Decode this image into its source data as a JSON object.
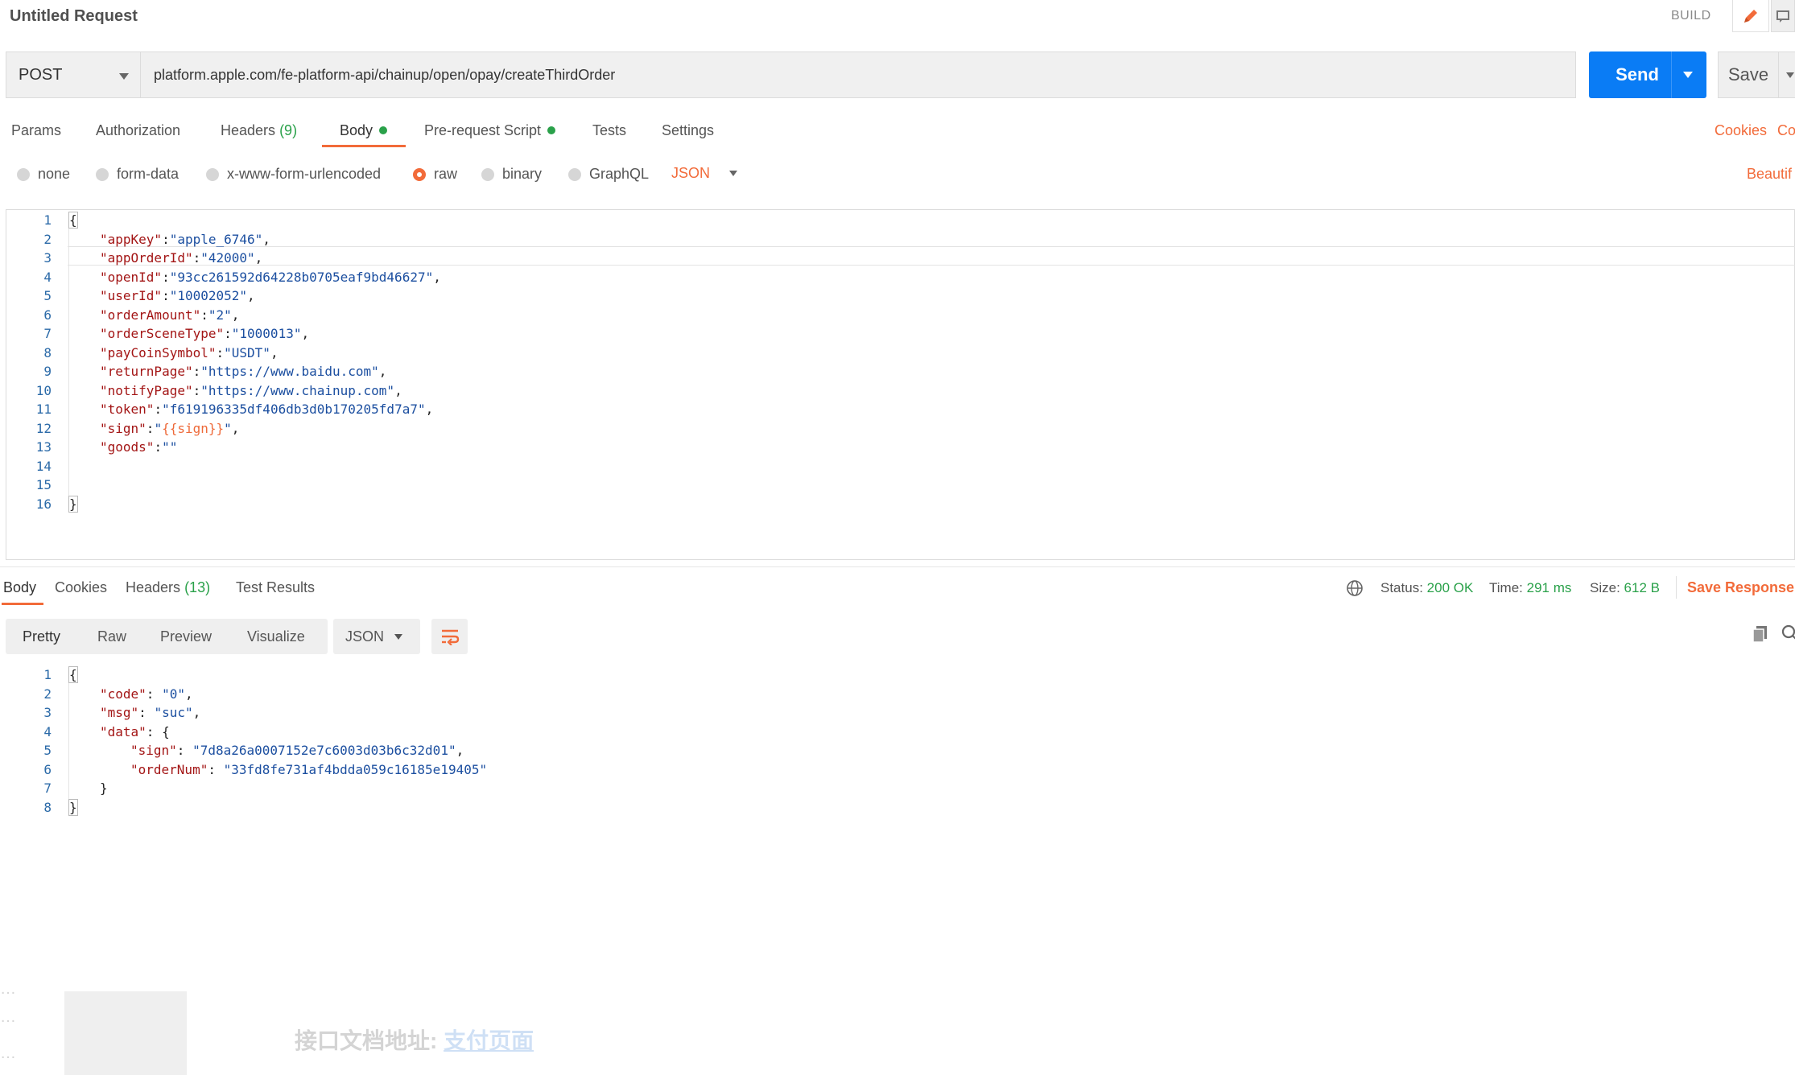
{
  "header": {
    "title": "Untitled Request",
    "build_label": "BUILD"
  },
  "request": {
    "method": "POST",
    "url": "platform.apple.com/fe-platform-api/chainup/open/opay/createThirdOrder",
    "send_label": "Send",
    "save_label": "Save"
  },
  "tabs": [
    {
      "label": "Params"
    },
    {
      "label": "Authorization"
    },
    {
      "label": "Headers",
      "count": "(9)"
    },
    {
      "label": "Body",
      "active": true
    },
    {
      "label": "Pre-request Script"
    },
    {
      "label": "Tests"
    },
    {
      "label": "Settings"
    }
  ],
  "tab_links": {
    "cookies": "Cookies",
    "code": "Co"
  },
  "body_types": [
    "none",
    "form-data",
    "x-www-form-urlencoded",
    "raw",
    "binary",
    "GraphQL"
  ],
  "body_type_selected": "raw",
  "body_format": "JSON",
  "beautify_label": "Beautif",
  "request_body": [
    {
      "n": "1",
      "key": "",
      "value": "",
      "brace": "{"
    },
    {
      "n": "2",
      "key": "\"appKey\"",
      "value": "\"apple_6746\"",
      "sep": ":",
      "tail": ","
    },
    {
      "n": "3",
      "key": "\"appOrderId\"",
      "value": "\"42000\"",
      "sep": ":",
      "tail": ","
    },
    {
      "n": "4",
      "key": "\"openId\"",
      "value": "\"93cc261592d64228b0705eaf9bd46627\"",
      "sep": ":",
      "tail": ","
    },
    {
      "n": "5",
      "key": "\"userId\"",
      "value": "\"10002052\"",
      "sep": ":",
      "tail": ","
    },
    {
      "n": "6",
      "key": "\"orderAmount\"",
      "value": "\"2\"",
      "sep": ":",
      "tail": ","
    },
    {
      "n": "7",
      "key": "\"orderSceneType\"",
      "value": "\"1000013\"",
      "sep": ":",
      "tail": ","
    },
    {
      "n": "8",
      "key": "\"payCoinSymbol\"",
      "value": "\"USDT\"",
      "sep": ":",
      "tail": ","
    },
    {
      "n": "9",
      "key": "\"returnPage\"",
      "value": "\"https://www.baidu.com\"",
      "sep": ":",
      "tail": ","
    },
    {
      "n": "10",
      "key": "\"notifyPage\"",
      "value": "\"https://www.chainup.com\"",
      "sep": ":",
      "tail": ","
    },
    {
      "n": "11",
      "key": "\"token\"",
      "value": "\"f619196335df406db3d0b170205fd7a7\"",
      "sep": ":",
      "tail": ","
    },
    {
      "n": "12",
      "key": "\"sign\"",
      "value": "{{sign}}",
      "sep": ":",
      "tail": ",",
      "variable": true
    },
    {
      "n": "13",
      "key": "\"goods\"",
      "value": "\"\"",
      "sep": ":",
      "tail": ""
    },
    {
      "n": "14",
      "key": "",
      "value": ""
    },
    {
      "n": "15",
      "key": "",
      "value": ""
    },
    {
      "n": "16",
      "key": "",
      "value": "",
      "brace": "}"
    }
  ],
  "response_tabs": [
    {
      "label": "Body",
      "active": true
    },
    {
      "label": "Cookies"
    },
    {
      "label": "Headers",
      "count": "(13)"
    },
    {
      "label": "Test Results"
    }
  ],
  "status": {
    "status_label": "Status:",
    "status_value": "200 OK",
    "time_label": "Time:",
    "time_value": "291 ms",
    "size_label": "Size:",
    "size_value": "612 B",
    "save_response": "Save Response"
  },
  "view_modes": [
    "Pretty",
    "Raw",
    "Preview",
    "Visualize"
  ],
  "response_format": "JSON",
  "response_body": [
    {
      "n": "1",
      "text": "{"
    },
    {
      "n": "2",
      "key": "\"code\"",
      "value": "\"0\"",
      "indent": 1,
      "tail": ","
    },
    {
      "n": "3",
      "key": "\"msg\"",
      "value": "\"suc\"",
      "indent": 1,
      "tail": ","
    },
    {
      "n": "4",
      "key": "\"data\"",
      "value": "{",
      "indent": 1,
      "tail": "",
      "plainValue": true
    },
    {
      "n": "5",
      "key": "\"sign\"",
      "value": "\"7d8a26a0007152e7c6003d03b6c32d01\"",
      "indent": 2,
      "tail": ","
    },
    {
      "n": "6",
      "key": "\"orderNum\"",
      "value": "\"33fd8fe731af4bdda059c16185e19405\"",
      "indent": 2,
      "tail": ""
    },
    {
      "n": "7",
      "text": "}",
      "indent": 1
    },
    {
      "n": "8",
      "text": "}"
    }
  ],
  "overlay": {
    "line2_label": "接口文档地址:",
    "line2_link": "支付页面"
  },
  "colors": {
    "accent": "#f26b3a",
    "primary": "#0a7cf5",
    "success": "#2aa14a"
  }
}
